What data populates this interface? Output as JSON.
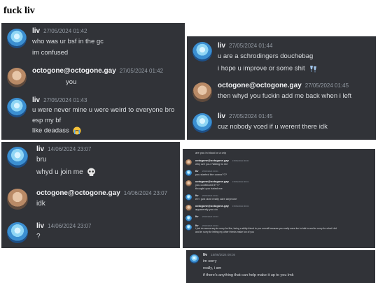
{
  "page_title": "fuck liv",
  "panel1": {
    "m1": {
      "author": "liv",
      "time": "27/05/2024 01:42",
      "lines": [
        "who was ur bsf in the gc",
        "im confused"
      ]
    },
    "m2": {
      "author": "octogone@octogone.gay",
      "time": "27/05/2024 01:42",
      "lines": [
        "you"
      ]
    },
    "m3": {
      "author": "liv",
      "time": "27/05/2024 01:43",
      "lines": [
        "u were never mine u were weird to everyone bro",
        "esp my bf",
        "like deadass"
      ]
    }
  },
  "panel2": {
    "m1": {
      "author": "liv",
      "time": "27/05/2024 01:44",
      "lines": [
        "u are a schrodingers douchebag",
        "i hope u improve or some shit"
      ]
    },
    "m2": {
      "author": "octogone@octogone.gay",
      "time": "27/05/2024 01:45",
      "lines": [
        "then whyd you fuckin add me back when i left"
      ]
    },
    "m3": {
      "author": "liv",
      "time": "27/05/2024 01:45",
      "lines": [
        "cuz nobody vced if u werent there idk"
      ]
    }
  },
  "panel3": {
    "m1": {
      "author": "liv",
      "time": "14/06/2024 23:07",
      "lines": [
        "bru",
        "whyd u join me"
      ]
    },
    "m2": {
      "author": "octogone@octogone.gay",
      "time": "14/06/2024 23:07",
      "lines": [
        "idk"
      ]
    },
    "m3": {
      "author": "liv",
      "time": "14/06/2024 23:07",
      "lines": [
        "?"
      ]
    }
  },
  "panel4": {
    "top_line": "are you in blood or a crip",
    "m1": {
      "author": "octogone@octogone.gay",
      "time": "15/06/2024 00:00",
      "lines": [
        "why are you ?alking to me"
      ]
    },
    "m2": {
      "author": "liv",
      "time": "15/06/2024 00:01",
      "lines": [
        "you started the convo???"
      ]
    },
    "m3": {
      "author": "octogone@octogone.gay",
      "time": "15/06/2024 00:01",
      "lines": [
        "you continued it???",
        "thought you hated me"
      ]
    },
    "m4": {
      "author": "liv",
      "time": "15/06/2024 00:01",
      "lines": [
        "err i just dont really care anymore"
      ]
    },
    "m5": {
      "author": "octogone@octogone.gay",
      "time": "15/06/2024 00:02",
      "lines": [
        "apparently you do"
      ]
    },
    "m6": {
      "author": "liv",
      "time": "15/06/2024 00:03",
      "lines": []
    },
    "m7": {
      "author": "liv",
      "time": "15/06/2024 00:03",
      "lines": [
        "i just do wanna say im sorry for like, being a shitty friend to you overall because you really were fun to talk to and im sorry for what i did",
        "and im sorry for letting my other friends make fun of you"
      ]
    }
  },
  "panel5": {
    "m1": {
      "author": "liv",
      "time": "15/06/2024 00:04",
      "lines": [
        "im sorry",
        "really, i am",
        "if there's anything that can help make it up to you lmk"
      ]
    }
  },
  "colors": {
    "panel_bg": "#313338",
    "name": "#f2f3f5",
    "timestamp": "#949ba4",
    "text": "#dbdee1"
  }
}
